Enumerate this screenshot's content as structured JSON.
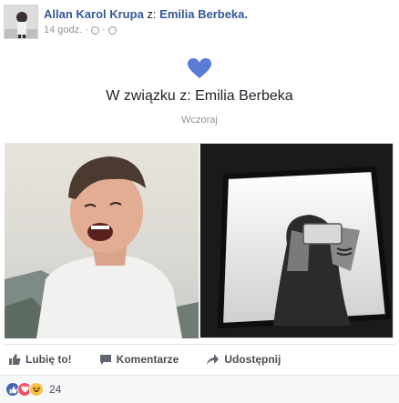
{
  "post": {
    "author": "Allan Karol Krupa",
    "tag_prefix": "z:",
    "tagged_name": "Emilia Berbeka.",
    "time": "14 godz.",
    "relationship": {
      "title": "W związku z: Emilia Berbeka",
      "date": "Wczoraj"
    }
  },
  "actions": {
    "like": "Lubię to!",
    "comment": "Komentarze",
    "share": "Udostępnij"
  },
  "reactions": {
    "icons": [
      "like-icon",
      "love-icon",
      "haha-icon"
    ],
    "count": "24"
  },
  "colors": {
    "link": "#365899",
    "heart": "#5b7bd5",
    "like_blue": "#4267b2",
    "love_red": "#f25268",
    "haha_yellow": "#f7c244",
    "meta_gray": "#90949c",
    "reaction_bar_bg": "#f6f7f9"
  }
}
